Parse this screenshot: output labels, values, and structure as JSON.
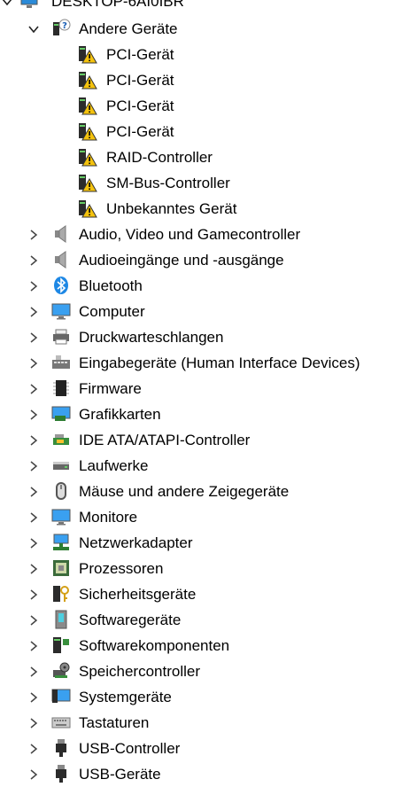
{
  "root": {
    "label": "DESKTOP-6AI0IBR",
    "icon": "computer-icon"
  },
  "expanded_category": {
    "label": "Andere Geräte",
    "icon": "unknown-device-icon",
    "children": [
      {
        "label": "PCI-Gerät",
        "icon": "warning-device-icon"
      },
      {
        "label": "PCI-Gerät",
        "icon": "warning-device-icon"
      },
      {
        "label": "PCI-Gerät",
        "icon": "warning-device-icon"
      },
      {
        "label": "PCI-Gerät",
        "icon": "warning-device-icon"
      },
      {
        "label": "RAID-Controller",
        "icon": "warning-device-icon"
      },
      {
        "label": "SM-Bus-Controller",
        "icon": "warning-device-icon"
      },
      {
        "label": "Unbekanntes Gerät",
        "icon": "warning-device-icon"
      }
    ]
  },
  "categories": [
    {
      "label": "Audio, Video und Gamecontroller",
      "icon": "speaker-icon"
    },
    {
      "label": "Audioeingänge und -ausgänge",
      "icon": "speaker-icon"
    },
    {
      "label": "Bluetooth",
      "icon": "bluetooth-icon"
    },
    {
      "label": "Computer",
      "icon": "monitor-icon"
    },
    {
      "label": "Druckwarteschlangen",
      "icon": "printer-icon"
    },
    {
      "label": "Eingabegeräte (Human Interface Devices)",
      "icon": "hid-icon"
    },
    {
      "label": "Firmware",
      "icon": "chip-icon"
    },
    {
      "label": "Grafikkarten",
      "icon": "display-adapter-icon"
    },
    {
      "label": "IDE ATA/ATAPI-Controller",
      "icon": "ide-controller-icon"
    },
    {
      "label": "Laufwerke",
      "icon": "disk-drive-icon"
    },
    {
      "label": "Mäuse und andere Zeigegeräte",
      "icon": "mouse-icon"
    },
    {
      "label": "Monitore",
      "icon": "monitor-icon"
    },
    {
      "label": "Netzwerkadapter",
      "icon": "network-icon"
    },
    {
      "label": "Prozessoren",
      "icon": "processor-icon"
    },
    {
      "label": "Sicherheitsgeräte",
      "icon": "security-key-icon"
    },
    {
      "label": "Softwaregeräte",
      "icon": "software-device-icon"
    },
    {
      "label": "Softwarekomponenten",
      "icon": "software-component-icon"
    },
    {
      "label": "Speichercontroller",
      "icon": "storage-controller-icon"
    },
    {
      "label": "Systemgeräte",
      "icon": "system-device-icon"
    },
    {
      "label": "Tastaturen",
      "icon": "keyboard-icon"
    },
    {
      "label": "USB-Controller",
      "icon": "usb-icon"
    },
    {
      "label": "USB-Geräte",
      "icon": "usb-icon"
    }
  ]
}
